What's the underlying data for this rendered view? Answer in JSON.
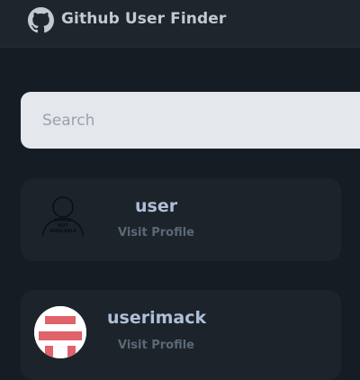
{
  "header": {
    "logo_icon": "github-icon",
    "title": "Github User Finder"
  },
  "search": {
    "placeholder": "Search",
    "value": ""
  },
  "users": [
    {
      "username": "user",
      "link_label": "Visit Profile",
      "avatar": "no-image-available-placeholder",
      "avatar_text": "IMAGE NOT AVAILABLE"
    },
    {
      "username": "userimack",
      "link_label": "Visit Profile",
      "avatar": "red-identicon"
    }
  ],
  "colors": {
    "background": "#161c23",
    "navbar": "#1e252d",
    "card": "#1c232b",
    "search_bg": "#e4e7ec",
    "username": "#aec0d6",
    "link": "#5c6875",
    "identicon": "#e0626a"
  }
}
